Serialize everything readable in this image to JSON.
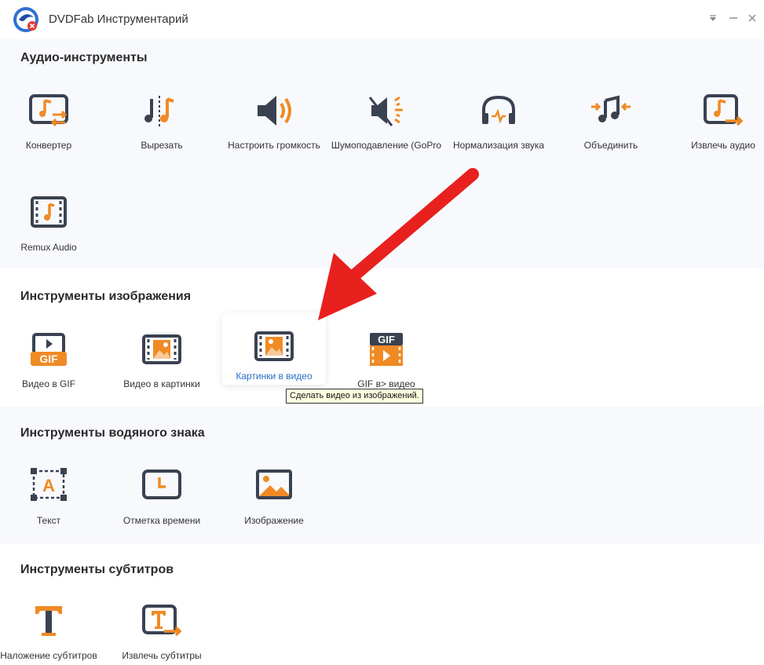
{
  "window": {
    "title": "DVDFab Инструментарий",
    "controls": [
      "dropdown-icon",
      "minimize-icon",
      "close-icon"
    ]
  },
  "sections": {
    "audio": {
      "title": "Аудио-инструменты",
      "items": [
        "Конвертер",
        "Вырезать",
        "Настроить громкость",
        "Шумоподавление (GoPro",
        "Нормализация звука",
        "Объединить",
        "Извлечь аудио",
        "Remux Audio"
      ]
    },
    "image": {
      "title": "Инструменты изображения",
      "items": [
        "Видео в GIF",
        "Видео в картинки",
        "Картинки в видео",
        "GIF в> видео"
      ]
    },
    "watermark": {
      "title": "Инструменты водяного знака",
      "items": [
        "Текст",
        "Отметка времени",
        "Изображение"
      ]
    },
    "subtitle": {
      "title": "Инструменты субтитров",
      "items": [
        "Наложение субтитров",
        "Извлечь субтитры"
      ]
    }
  },
  "tooltip": "Сделать видео из изображений.",
  "colors": {
    "accent": "#f08a24",
    "icon_dark": "#3a4251",
    "highlight_text": "#2a6fc9",
    "arrow": "#e8201e"
  }
}
